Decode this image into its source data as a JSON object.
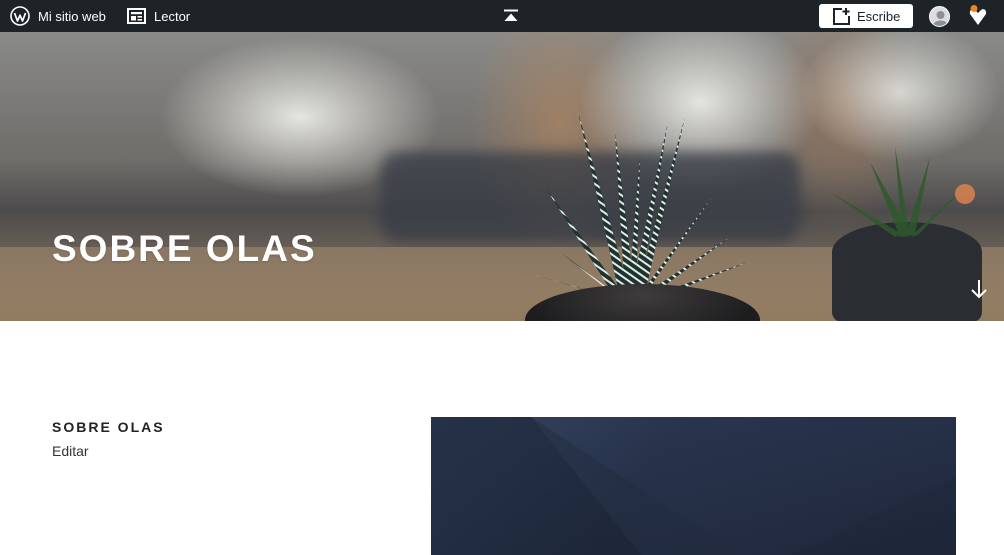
{
  "adminbar": {
    "site_label": "Mi sitio web",
    "reader_label": "Lector",
    "write_label": "Escribe",
    "icons": {
      "site": "wordpress-logo-icon",
      "reader": "reader-icon",
      "center": "collapse-up-icon",
      "write": "new-post-icon",
      "avatar": "user-avatar-icon",
      "notifications": "notifications-icon"
    },
    "notification_dot_color": "#f0821e"
  },
  "hero": {
    "title": "SOBRE OLAS",
    "scroll_icon": "arrow-down-icon"
  },
  "content": {
    "page_title": "SOBRE OLAS",
    "edit_label": "Editar"
  },
  "colors": {
    "adminbar_bg": "#1d2327",
    "page_bg": "#ffffff",
    "title_text": "#222222"
  }
}
